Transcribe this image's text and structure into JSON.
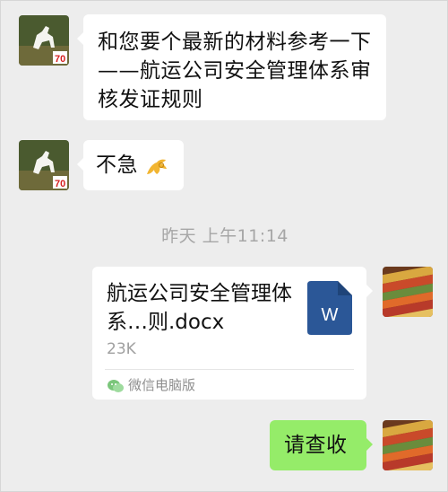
{
  "messages": [
    {
      "sender": "contact",
      "text": "和您要个最新的材料参考一下——航运公司安全管理体系审核发证规则"
    },
    {
      "sender": "contact",
      "text": "不急",
      "emoji": "ok-hand-emoji"
    },
    {
      "sender": "me",
      "type": "file",
      "file": {
        "name": "航运公司安全管理体系…则.docx",
        "size": "23K",
        "source": "微信电脑版",
        "icon": "word-doc-icon",
        "icon_letter": "W"
      }
    },
    {
      "sender": "me",
      "text": "请查收"
    }
  ],
  "timestamp": "昨天 上午11:14",
  "colors": {
    "background": "#ededed",
    "bubble_other": "#ffffff",
    "bubble_self": "#95ec69",
    "word_blue": "#2b5797"
  }
}
